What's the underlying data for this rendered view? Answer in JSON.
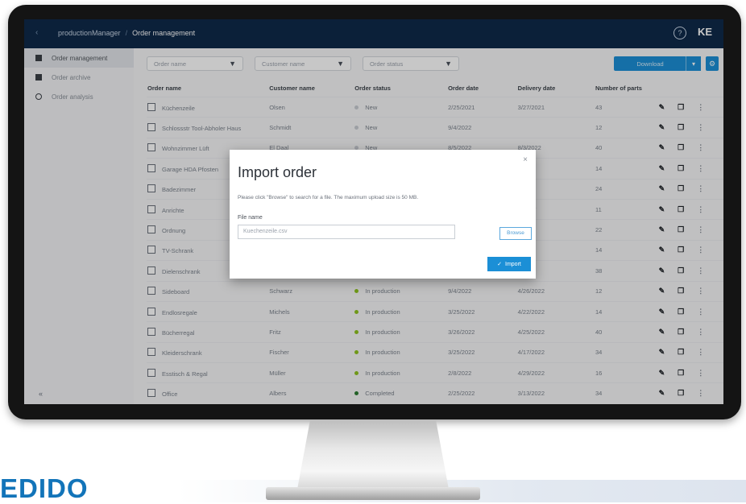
{
  "brand": "EDIDO",
  "topbar": {
    "back_icon": "‹",
    "app": "productionManager",
    "separator": "/",
    "page": "Order management",
    "help_icon": "?",
    "user": "KE"
  },
  "sidebar": {
    "items": [
      {
        "label": "Order management",
        "icon": "grid-icon"
      },
      {
        "label": "Order archive",
        "icon": "archive-icon"
      },
      {
        "label": "Order analysis",
        "icon": "clock-icon"
      }
    ],
    "collapse": "«"
  },
  "filters": [
    {
      "placeholder": "Order name",
      "icon": "funnel-icon"
    },
    {
      "placeholder": "Customer name",
      "icon": "funnel-icon"
    },
    {
      "placeholder": "Order status",
      "icon": "funnel-icon"
    }
  ],
  "toolbar": {
    "download_label": "Download",
    "gear": "⚙"
  },
  "table": {
    "columns": [
      "Order name",
      "Customer name",
      "Order status",
      "Order date",
      "Delivery date",
      "Number of parts"
    ],
    "rows": [
      {
        "name": "Küchenzeile",
        "customer": "Olsen",
        "status": "New",
        "status_color": "#c8ccd2",
        "order_date": "2/25/2021",
        "delivery": "3/27/2021",
        "parts": "43"
      },
      {
        "name": "Schlossstr Tool-Abholer Haus",
        "customer": "Schmidt",
        "status": "New",
        "status_color": "#c8ccd2",
        "order_date": "9/4/2022",
        "delivery": "",
        "parts": "12"
      },
      {
        "name": "Wohnzimmer Lüft",
        "customer": "El Daal",
        "status": "New",
        "status_color": "#c8ccd2",
        "order_date": "8/5/2022",
        "delivery": "8/3/2022",
        "parts": "40"
      },
      {
        "name": "Garage HDA Pfosten",
        "customer": "",
        "status": "",
        "status_color": "",
        "order_date": "",
        "delivery": "/2022",
        "parts": "14"
      },
      {
        "name": "Badezimmer",
        "customer": "",
        "status": "",
        "status_color": "",
        "order_date": "",
        "delivery": "",
        "parts": "24"
      },
      {
        "name": "Anrichte",
        "customer": "",
        "status": "",
        "status_color": "",
        "order_date": "",
        "delivery": "1/2017",
        "parts": "11"
      },
      {
        "name": "Ordnung",
        "customer": "",
        "status": "",
        "status_color": "",
        "order_date": "",
        "delivery": "",
        "parts": "22"
      },
      {
        "name": "TV-Schrank",
        "customer": "",
        "status": "",
        "status_color": "",
        "order_date": "",
        "delivery": "/2022",
        "parts": "14"
      },
      {
        "name": "Dielenschrank",
        "customer": "",
        "status": "",
        "status_color": "",
        "order_date": "",
        "delivery": "2022",
        "parts": "38"
      },
      {
        "name": "Sideboard",
        "customer": "Schwarz",
        "status": "In production",
        "status_color": "#8fc31f",
        "order_date": "9/4/2022",
        "delivery": "4/26/2022",
        "parts": "12"
      },
      {
        "name": "Endlosregale",
        "customer": "Michels",
        "status": "In production",
        "status_color": "#8fc31f",
        "order_date": "3/25/2022",
        "delivery": "4/22/2022",
        "parts": "14"
      },
      {
        "name": "Bücherregal",
        "customer": "Fritz",
        "status": "In production",
        "status_color": "#8fc31f",
        "order_date": "3/26/2022",
        "delivery": "4/25/2022",
        "parts": "40"
      },
      {
        "name": "Kleiderschrank",
        "customer": "Fischer",
        "status": "In production",
        "status_color": "#8fc31f",
        "order_date": "3/25/2022",
        "delivery": "4/17/2022",
        "parts": "34"
      },
      {
        "name": "Esstisch & Regal",
        "customer": "Müller",
        "status": "In production",
        "status_color": "#8fc31f",
        "order_date": "2/8/2022",
        "delivery": "4/29/2022",
        "parts": "16"
      },
      {
        "name": "Office",
        "customer": "Albers",
        "status": "Completed",
        "status_color": "#2e7d32",
        "order_date": "2/25/2022",
        "delivery": "3/13/2022",
        "parts": "34"
      }
    ],
    "actions": {
      "edit": "✎",
      "copy": "❐",
      "more": "⋮"
    }
  },
  "dialog": {
    "title": "Import order",
    "description": "Please click \"Browse\" to search for a file. The maximum upload size is 50 MB.",
    "file_label": "File name",
    "file_placeholder": "Kuechenzeile.csv",
    "browse": "Browse",
    "import": "Import",
    "check": "✓",
    "close": "×"
  }
}
